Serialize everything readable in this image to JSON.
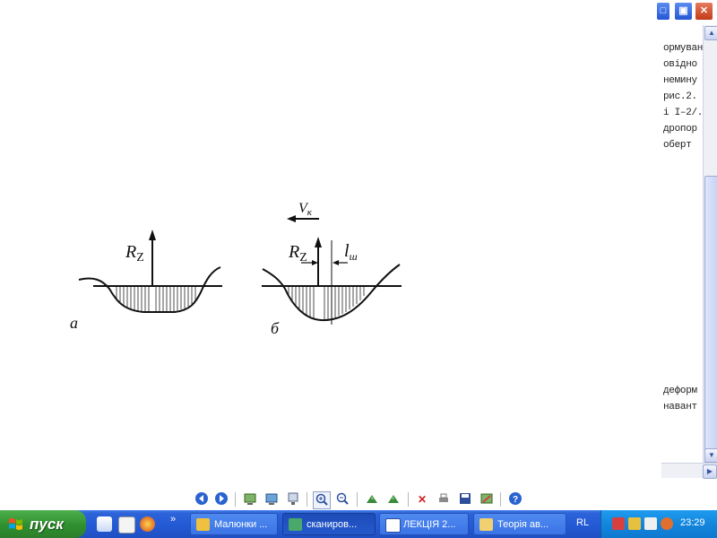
{
  "figure": {
    "vk_label": "V",
    "vk_sub": "к",
    "rz_left": "R",
    "rz_left_sub": "Z",
    "rz_right": "R",
    "rz_right_sub": "Z",
    "lsh_label": "l",
    "lsh_sub": "ш",
    "caption_a": "а",
    "caption_b": "б"
  },
  "document_snippets": {
    "top": [
      "ормуван",
      "овідно",
      "немину",
      "рис.2.",
      "і І–2/.",
      "дропор",
      "оберт"
    ],
    "bottom": [
      "деформ",
      "навант"
    ]
  },
  "window_controls": {
    "minimize": "□",
    "restore": "▣",
    "close": "✕"
  },
  "viewer_toolbar": {
    "icons": [
      "prev-image-icon",
      "next-image-icon",
      "best-fit-icon",
      "actual-size-icon",
      "slideshow-icon",
      "zoom-in-icon",
      "zoom-out-icon",
      "rotate-clockwise-icon",
      "rotate-counterclockwise-icon",
      "delete-icon",
      "print-icon",
      "save-icon",
      "edit-icon",
      "help-icon"
    ]
  },
  "taskbar": {
    "start_label": "пуск",
    "tasks": [
      {
        "label": "Малюнки ...",
        "active": false,
        "icon": "folder-icon",
        "color": "#f0c040"
      },
      {
        "label": "сканиров...",
        "active": true,
        "icon": "image-viewer-icon",
        "color": "#4aa86a"
      },
      {
        "label": "ЛЕКЦІЯ 2...",
        "active": false,
        "icon": "word-icon",
        "color": "#ffffff"
      },
      {
        "label": "Теорія ав...",
        "active": false,
        "icon": "paint-icon",
        "color": "#f0d070"
      }
    ],
    "language": "RL",
    "clock": "23:29"
  },
  "colors": {
    "taskbar": "#245bd6",
    "start": "#2f8f2f",
    "tray": "#1486dc"
  }
}
